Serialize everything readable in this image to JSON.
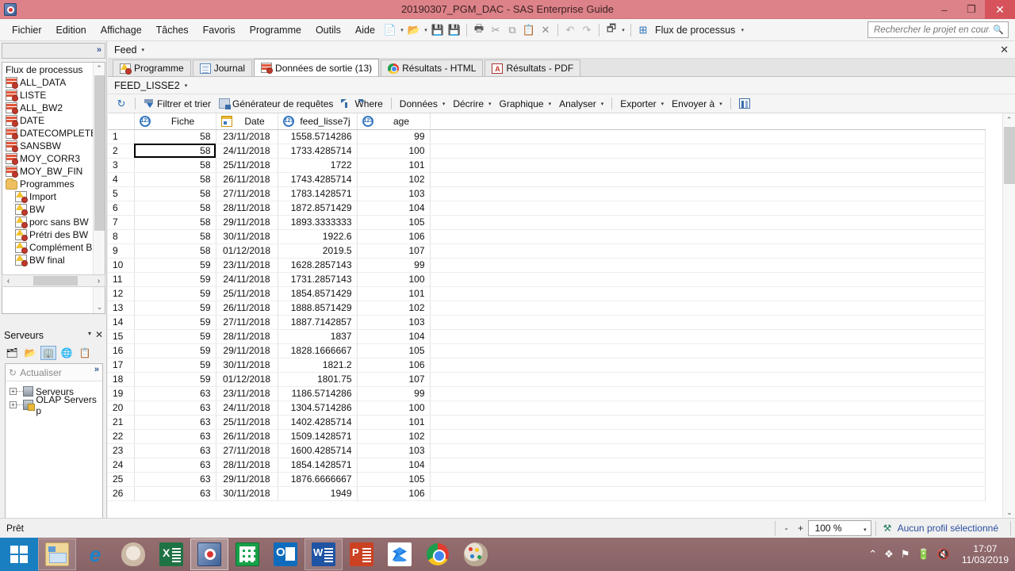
{
  "window": {
    "title": "20190307_PGM_DAC - SAS Enterprise Guide",
    "app_icon": "sas-eg-icon",
    "minimize": "–",
    "maximize": "❐",
    "close": "✕"
  },
  "menubar": {
    "items": [
      "Fichier",
      "Edition",
      "Affichage",
      "Tâches",
      "Favoris",
      "Programme",
      "Outils",
      "Aide"
    ],
    "toolbar_icons": [
      "new-document-icon",
      "open-folder-icon",
      "save-icon",
      "save-all-icon",
      "print-icon",
      "cut-icon",
      "copy-icon",
      "paste-icon",
      "delete-icon",
      "undo-icon",
      "redo-icon",
      "window-layout-icon"
    ],
    "process_flow_label": "Flux de processus"
  },
  "search": {
    "placeholder": "Rechercher le projet en cours",
    "value": "",
    "icon": "search-icon"
  },
  "left_dock": {
    "process_flow": {
      "expand_label": "»",
      "title": "Flux de processus",
      "datasets": [
        "ALL_DATA",
        "LISTE",
        "ALL_BW2",
        "DATE",
        "DATECOMPLETE",
        "SANSBW",
        "MOY_CORR3",
        "MOY_BW_FIN"
      ],
      "folder": "Programmes",
      "programs": [
        "Import",
        "BW",
        "porc sans BW",
        "Prétri des BW",
        "Complément B'",
        "BW final"
      ]
    },
    "servers": {
      "title": "Serveurs",
      "dropdown_icon": "chevron-down-icon",
      "close_icon": "close-icon",
      "toolbar_icons": [
        "new-data-icon",
        "open-folder-icon",
        "server-icon",
        "web-icon",
        "list-icon"
      ],
      "refresh_label": "Actualiser",
      "refresh_icon": "refresh-icon",
      "overflow": "»",
      "nodes": [
        "Serveurs",
        "OLAP Servers p"
      ]
    }
  },
  "main": {
    "feed": {
      "label": "Feed",
      "caret": "▾",
      "close": "✕"
    },
    "tabs": [
      {
        "label": "Programme",
        "icon": "program-icon",
        "active": false
      },
      {
        "label": "Journal",
        "icon": "log-icon",
        "active": false
      },
      {
        "label": "Données de sortie (13)",
        "icon": "output-data-icon",
        "active": true
      },
      {
        "label": "Résultats - HTML",
        "icon": "chrome-icon",
        "active": false
      },
      {
        "label": "Résultats - PDF",
        "icon": "pdf-icon",
        "active": false
      }
    ],
    "dataset_name": "FEED_LISSE2",
    "dataset_caret": "▾",
    "grid_toolbar": [
      {
        "label": "",
        "icon": "refresh-icon",
        "caret": false
      },
      {
        "label": "Filtrer et trier",
        "icon": "filter-sort-icon",
        "caret": false
      },
      {
        "label": "Générateur de requêtes",
        "icon": "query-builder-icon",
        "caret": false
      },
      {
        "label": "Where",
        "icon": "where-filter-icon",
        "caret": false
      },
      {
        "label": "Données",
        "icon": "",
        "caret": true
      },
      {
        "label": "Décrire",
        "icon": "",
        "caret": true
      },
      {
        "label": "Graphique",
        "icon": "",
        "caret": true
      },
      {
        "label": "Analyser",
        "icon": "",
        "caret": true
      },
      {
        "label": "Exporter",
        "icon": "",
        "caret": true
      },
      {
        "label": "Envoyer à",
        "icon": "",
        "caret": true
      },
      {
        "label": "",
        "icon": "column-properties-icon",
        "caret": false
      }
    ]
  },
  "table": {
    "columns": [
      {
        "name": "Fiche",
        "type_icon": "numeric-icon"
      },
      {
        "name": "Date",
        "type_icon": "date-icon"
      },
      {
        "name": "feed_lisse7j",
        "type_icon": "numeric-icon"
      },
      {
        "name": "age",
        "type_icon": "numeric-icon"
      }
    ],
    "selected_cell": {
      "row": 2,
      "column": "Fiche"
    },
    "rows": [
      {
        "n": "1",
        "Fiche": "58",
        "Date": "23/11/2018",
        "feed_lisse7j": "1558.5714286",
        "age": "99"
      },
      {
        "n": "2",
        "Fiche": "58",
        "Date": "24/11/2018",
        "feed_lisse7j": "1733.4285714",
        "age": "100"
      },
      {
        "n": "3",
        "Fiche": "58",
        "Date": "25/11/2018",
        "feed_lisse7j": "1722",
        "age": "101"
      },
      {
        "n": "4",
        "Fiche": "58",
        "Date": "26/11/2018",
        "feed_lisse7j": "1743.4285714",
        "age": "102"
      },
      {
        "n": "5",
        "Fiche": "58",
        "Date": "27/11/2018",
        "feed_lisse7j": "1783.1428571",
        "age": "103"
      },
      {
        "n": "6",
        "Fiche": "58",
        "Date": "28/11/2018",
        "feed_lisse7j": "1872.8571429",
        "age": "104"
      },
      {
        "n": "7",
        "Fiche": "58",
        "Date": "29/11/2018",
        "feed_lisse7j": "1893.3333333",
        "age": "105"
      },
      {
        "n": "8",
        "Fiche": "58",
        "Date": "30/11/2018",
        "feed_lisse7j": "1922.6",
        "age": "106"
      },
      {
        "n": "9",
        "Fiche": "58",
        "Date": "01/12/2018",
        "feed_lisse7j": "2019.5",
        "age": "107"
      },
      {
        "n": "10",
        "Fiche": "59",
        "Date": "23/11/2018",
        "feed_lisse7j": "1628.2857143",
        "age": "99"
      },
      {
        "n": "11",
        "Fiche": "59",
        "Date": "24/11/2018",
        "feed_lisse7j": "1731.2857143",
        "age": "100"
      },
      {
        "n": "12",
        "Fiche": "59",
        "Date": "25/11/2018",
        "feed_lisse7j": "1854.8571429",
        "age": "101"
      },
      {
        "n": "13",
        "Fiche": "59",
        "Date": "26/11/2018",
        "feed_lisse7j": "1888.8571429",
        "age": "102"
      },
      {
        "n": "14",
        "Fiche": "59",
        "Date": "27/11/2018",
        "feed_lisse7j": "1887.7142857",
        "age": "103"
      },
      {
        "n": "15",
        "Fiche": "59",
        "Date": "28/11/2018",
        "feed_lisse7j": "1837",
        "age": "104"
      },
      {
        "n": "16",
        "Fiche": "59",
        "Date": "29/11/2018",
        "feed_lisse7j": "1828.1666667",
        "age": "105"
      },
      {
        "n": "17",
        "Fiche": "59",
        "Date": "30/11/2018",
        "feed_lisse7j": "1821.2",
        "age": "106"
      },
      {
        "n": "18",
        "Fiche": "59",
        "Date": "01/12/2018",
        "feed_lisse7j": "1801.75",
        "age": "107"
      },
      {
        "n": "19",
        "Fiche": "63",
        "Date": "23/11/2018",
        "feed_lisse7j": "1186.5714286",
        "age": "99"
      },
      {
        "n": "20",
        "Fiche": "63",
        "Date": "24/11/2018",
        "feed_lisse7j": "1304.5714286",
        "age": "100"
      },
      {
        "n": "21",
        "Fiche": "63",
        "Date": "25/11/2018",
        "feed_lisse7j": "1402.4285714",
        "age": "101"
      },
      {
        "n": "22",
        "Fiche": "63",
        "Date": "26/11/2018",
        "feed_lisse7j": "1509.1428571",
        "age": "102"
      },
      {
        "n": "23",
        "Fiche": "63",
        "Date": "27/11/2018",
        "feed_lisse7j": "1600.4285714",
        "age": "103"
      },
      {
        "n": "24",
        "Fiche": "63",
        "Date": "28/11/2018",
        "feed_lisse7j": "1854.1428571",
        "age": "104"
      },
      {
        "n": "25",
        "Fiche": "63",
        "Date": "29/11/2018",
        "feed_lisse7j": "1876.6666667",
        "age": "105"
      },
      {
        "n": "26",
        "Fiche": "63",
        "Date": "30/11/2018",
        "feed_lisse7j": "1949",
        "age": "106"
      }
    ]
  },
  "statusbar": {
    "ready": "Prêt",
    "zoom_out": "-",
    "zoom_in": "+",
    "zoom_value": "100 %",
    "zoom_caret": "▾",
    "profile": "Aucun profil sélectionné",
    "profile_icon": "profile-icon"
  },
  "taskbar": {
    "start_icon": "windows-start-icon",
    "apps": [
      {
        "name": "file-explorer",
        "state": "open"
      },
      {
        "name": "internet-explorer",
        "state": "pinned"
      },
      {
        "name": "moth-app",
        "state": "pinned"
      },
      {
        "name": "excel",
        "state": "pinned"
      },
      {
        "name": "sas-enterprise-guide",
        "state": "active"
      },
      {
        "name": "calculator",
        "state": "pinned"
      },
      {
        "name": "outlook",
        "state": "pinned"
      },
      {
        "name": "word",
        "state": "open"
      },
      {
        "name": "powerpoint",
        "state": "pinned"
      },
      {
        "name": "dropbox",
        "state": "pinned"
      },
      {
        "name": "chrome",
        "state": "pinned"
      },
      {
        "name": "paint",
        "state": "pinned"
      }
    ],
    "tray_icons": [
      "show-hidden-icons",
      "dropbox-tray-icon",
      "flag-icon",
      "battery-icon",
      "volume-muted-icon"
    ],
    "time": "17:07",
    "date": "11/03/2019"
  },
  "colors": {
    "titlebar": "#dd8288",
    "close_button": "#d6535b",
    "taskbar": "#8d6a6d",
    "accent_blue": "#2a6fb8",
    "link_blue": "#2a4fa0"
  }
}
